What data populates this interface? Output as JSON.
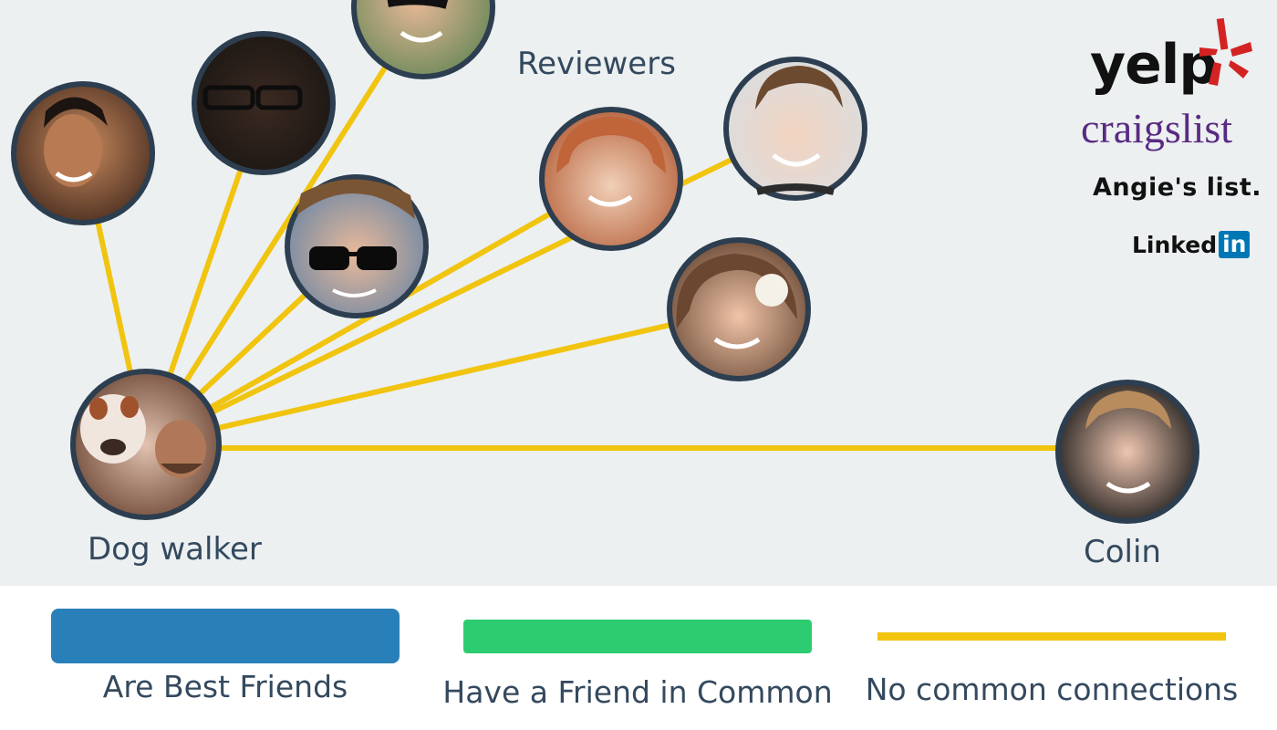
{
  "colors": {
    "background": "#ecf0f1",
    "connection_line": "#f1c40f",
    "node_border": "#2c3e50",
    "best_friends": "#2980b9",
    "friend_in_common": "#2ecc71",
    "no_common": "#f1c40f"
  },
  "labels": {
    "reviewers": "Reviewers",
    "dog_walker": "Dog walker",
    "colin": "Colin"
  },
  "logos": {
    "yelp": "yelp",
    "craigslist": "craigslist",
    "angies_list": "Angie's list.",
    "linkedin_text": "Linked",
    "linkedin_box": "in"
  },
  "legend": [
    {
      "label": "Are Best Friends",
      "color": "#2980b9"
    },
    {
      "label": "Have a Friend in Common",
      "color": "#2ecc71"
    },
    {
      "label": "No common connections",
      "color": "#f1c40f"
    }
  ]
}
